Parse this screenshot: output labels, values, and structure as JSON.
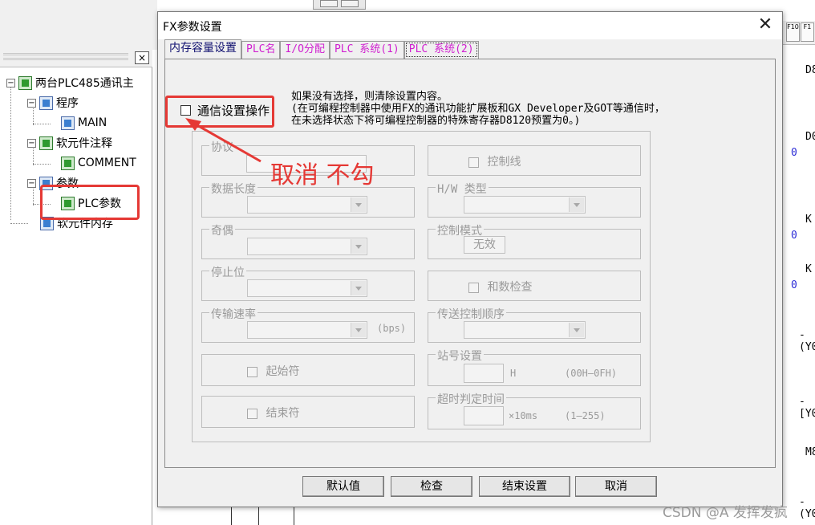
{
  "tree": {
    "root_label": "两台PLC485通讯主",
    "program_label": "程序",
    "main_label": "MAIN",
    "comment_group_label": "软元件注释",
    "comment_label": "COMMENT",
    "param_label": "参数",
    "plc_param_label": "PLC参数",
    "memory_label": "软元件内存",
    "close_label": "×"
  },
  "dialog": {
    "title": "FX参数设置",
    "close_label": "✕",
    "tabs": [
      "内存容量设置",
      "PLC名",
      "I/O分配",
      "PLC 系统(1)",
      "PLC 系统(2)"
    ],
    "main_checkbox_label": "通信设置操作",
    "info_lines": [
      "如果没有选择，则清除设置内容。",
      "(在可编程控制器中使用FX的通讯功能扩展板和GX Developer及GOT等通信时，",
      "在未选择状态下将可编程控制器的特殊寄存器D8120预置为0。)"
    ],
    "left_groups": {
      "protocol": "协议",
      "data_length": "数据长度",
      "parity": "奇偶",
      "stop_bit": "停止位",
      "baud_rate": "传输速率",
      "baud_unit": "(bps)",
      "start_char": "起始符",
      "end_char": "结束符"
    },
    "right_groups": {
      "control_line": "控制线",
      "hw_type": "H/W 类型",
      "control_mode": "控制模式",
      "control_mode_value": "无效",
      "sum_check": "和数检查",
      "transmit_order": "传送控制顺序",
      "station_no": "站号设置",
      "station_unit": "H",
      "station_range": "(00H—0FH)",
      "timeout": "超时判定时间",
      "timeout_unit": "×10ms",
      "timeout_range": "(1—255)"
    },
    "annotation": "取消 不勾",
    "buttons": {
      "default": "默认值",
      "check": "检查",
      "finish": "结束设置",
      "cancel": "取消"
    }
  },
  "right_strip": {
    "lines": [
      "D8",
      "D0",
      "0",
      "K",
      "0",
      "K",
      "0",
      "-(Y0",
      "-[Y0",
      "M8",
      "-(Y0"
    ]
  },
  "watermark": "CSDN @A  发挥发疯",
  "colors": {
    "annotation_red": "#e53935",
    "tab_magenta": "#d01fd0",
    "tab_active_text": "#101070",
    "dialog_bg": "#f0f0f0",
    "ladder_blue": "#2a2ad6"
  }
}
